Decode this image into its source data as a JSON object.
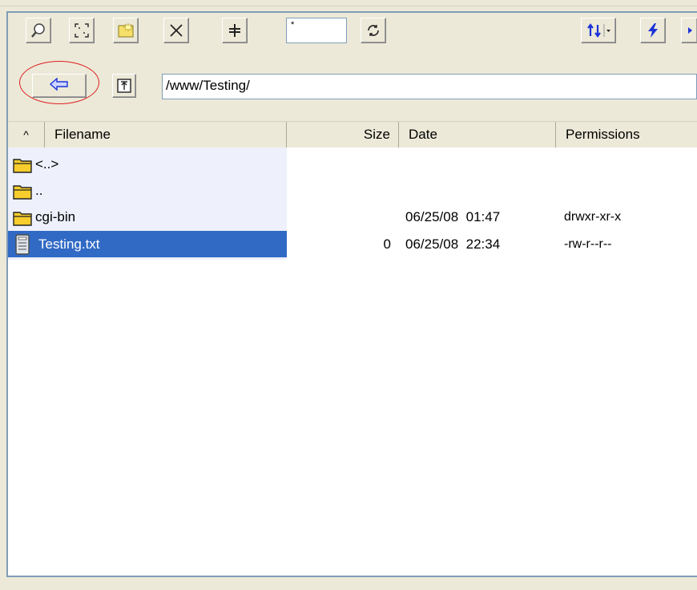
{
  "toolbar": {
    "mask_value": "*",
    "icons": [
      "find-icon",
      "select-all-icon",
      "new-folder-icon",
      "delete-icon",
      "compare-icon",
      "refresh-icon",
      "sort-icon",
      "connect-icon",
      "next-icon"
    ]
  },
  "navigation": {
    "back_icon": "back-arrow-icon",
    "up_icon": "parent-folder-icon",
    "path": "/www/Testing/"
  },
  "columns": {
    "sort_indicator": "^",
    "filename": "Filename",
    "size": "Size",
    "date": "Date",
    "permissions": "Permissions"
  },
  "files": [
    {
      "name": "<..>",
      "type": "folder",
      "size": "",
      "date": "",
      "permissions": "",
      "selected": false
    },
    {
      "name": "..",
      "type": "folder",
      "size": "",
      "date": "",
      "permissions": "",
      "selected": false
    },
    {
      "name": "cgi-bin",
      "type": "folder",
      "size": "",
      "date": "06/25/08  01:47",
      "permissions": "drwxr-xr-x",
      "selected": false
    },
    {
      "name": "Testing.txt",
      "type": "file",
      "size": "0",
      "date": "06/25/08  22:34",
      "permissions": "-rw-r--r--",
      "selected": true
    }
  ],
  "colors": {
    "selection": "#316ac5",
    "annotation_circle": "#e02020",
    "back_arrow": "#1c32d8",
    "folder": "#f6cd2c"
  }
}
